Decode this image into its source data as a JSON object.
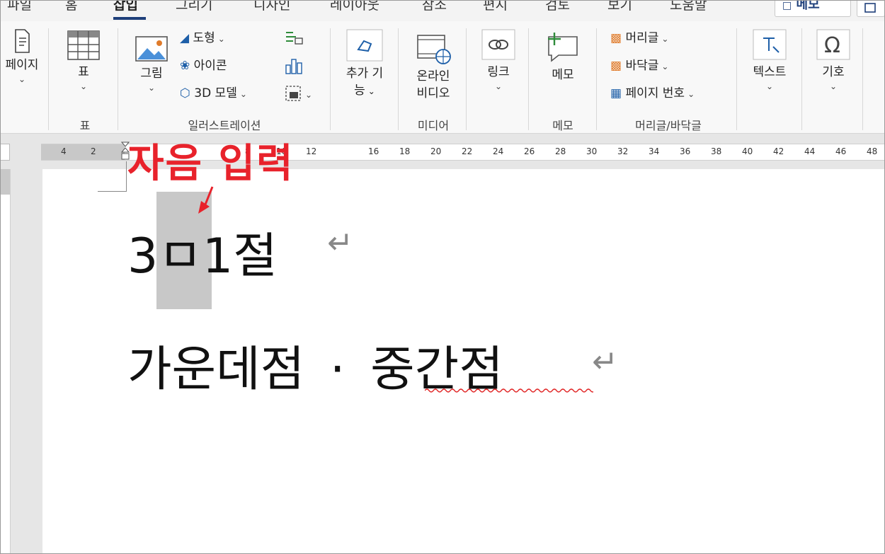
{
  "menu": {
    "tabs": [
      "파일",
      "홈",
      "삽입",
      "그리기",
      "디자인",
      "레이아웃",
      "참조",
      "편지",
      "검토",
      "보기",
      "도움말"
    ],
    "active_tab": "삽입",
    "memo_button": "메모"
  },
  "ribbon": {
    "page_label": "페이지",
    "table_label": "표",
    "table_group": "표",
    "picture_label": "그림",
    "shapes_label": "도형",
    "icons_label": "아이콘",
    "model3d_label": "3D 모델",
    "illustrations_group": "일러스트레이션",
    "addins_label_1": "추가 기",
    "addins_label_2": "능",
    "online_video_1": "온라인",
    "online_video_2": "비디오",
    "media_group": "미디어",
    "link_label": "링크",
    "comment_label": "메모",
    "comment_group": "메모",
    "header_label": "머리글",
    "footer_label": "바닥글",
    "page_number_label": "페이지 번호",
    "header_footer_group": "머리글/바닥글",
    "text_label": "텍스트",
    "symbol_label": "기호"
  },
  "ruler": {
    "ticks": [
      "4",
      "2",
      "",
      "",
      "",
      "8",
      "10",
      "12",
      "",
      "16",
      "18",
      "20",
      "22",
      "24",
      "26",
      "28",
      "30",
      "32",
      "34",
      "36",
      "38",
      "40",
      "42",
      "44",
      "46",
      "48"
    ]
  },
  "document": {
    "line1_a": "3",
    "line1_b": "ㅁ",
    "line1_c": "1절",
    "line2_a": "가운데점",
    "line2_b": "·",
    "line2_c": "중간점",
    "para_mark": "↵"
  },
  "annotation": {
    "text": "자음 입력",
    "color": "#e8222b"
  },
  "colors": {
    "accent": "#1e3f7a",
    "spellcheck": "#e02020",
    "highlight": "#c8c8c8"
  }
}
